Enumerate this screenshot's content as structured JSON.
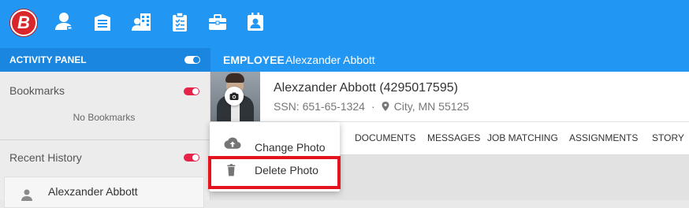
{
  "app": {
    "logo_letter": "B"
  },
  "toolbar": {
    "icons": [
      "person-badge-icon",
      "building-icon",
      "office-buildings-icon",
      "clipboard-check-icon",
      "briefcase-icon",
      "contact-card-icon"
    ]
  },
  "activity_panel": {
    "title": "ACTIVITY PANEL",
    "bookmarks": {
      "title": "Bookmarks",
      "empty_text": "No Bookmarks"
    },
    "recent_history": {
      "title": "Recent History",
      "items": [
        {
          "name": "Alexzander Abbott"
        }
      ]
    }
  },
  "employee": {
    "header_label": "EMPLOYEE",
    "header_name": "Alexzander Abbott",
    "display_name": "Alexzander Abbott (4295017595)",
    "ssn": "SSN: 651-65-1324",
    "separator": "·",
    "location": "City, MN 55125"
  },
  "tabs": [
    "DOCUMENTS",
    "MESSAGES",
    "JOB MATCHING",
    "ASSIGNMENTS",
    "STORY"
  ],
  "photo_menu": {
    "items": [
      {
        "label": "Change Photo",
        "icon": "cloud-upload-icon"
      },
      {
        "label": "Delete Photo",
        "icon": "trash-icon"
      }
    ]
  },
  "colors": {
    "accent": "#2196f3",
    "panel_header": "#1a86e0",
    "toggle_red": "#e8234a",
    "highlight": "#e3141d"
  }
}
